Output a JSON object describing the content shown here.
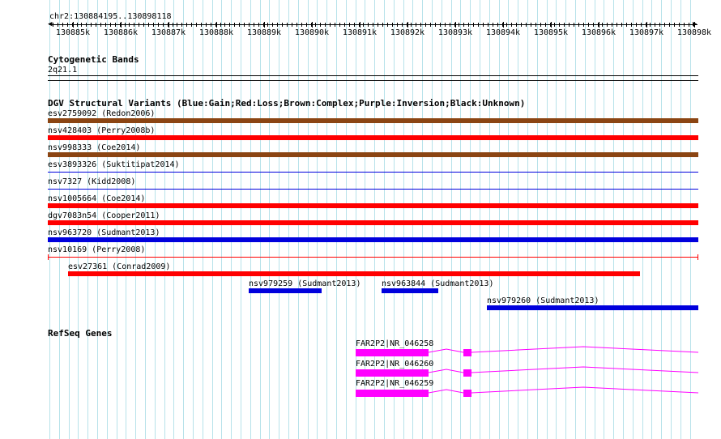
{
  "locus": "chr2:130884195..130898118",
  "ruler": {
    "ticks": [
      "130885k",
      "130886k",
      "130887k",
      "130888k",
      "130889k",
      "130890k",
      "130891k",
      "130892k",
      "130893k",
      "130894k",
      "130895k",
      "130896k",
      "130897k",
      "130898k"
    ]
  },
  "cyto": {
    "title": "Cytogenetic Bands",
    "band": "2q21.1"
  },
  "dgv": {
    "title": "DGV Structural Variants (Blue:Gain;Red:Loss;Brown:Complex;Purple:Inversion;Black:Unknown)",
    "colors": {
      "gain": "#0000dd",
      "loss": "#ff0000",
      "complex": "#8b4513",
      "unknown": "#000000"
    },
    "variants": [
      {
        "label": "esv2759092 (Redon2006)",
        "color": "#8b4513"
      },
      {
        "label": "nsv428403 (Perry2008b)",
        "color": "#ff0000"
      },
      {
        "label": "nsv998333 (Coe2014)",
        "color": "#8b4513"
      },
      {
        "label": "esv3893326 (Suktitipat2014)",
        "color": "#0000dd"
      },
      {
        "label": "nsv7327 (Kidd2008)",
        "color": "#0000dd"
      },
      {
        "label": "nsv1005664 (Coe2014)",
        "color": "#ff0000"
      },
      {
        "label": "dgv7083n54 (Cooper2011)",
        "color": "#ff0000"
      },
      {
        "label": "nsv963720 (Sudmant2013)",
        "color": "#0000dd"
      },
      {
        "label": "nsv10169 (Perry2008)",
        "color": "#ff0000"
      },
      {
        "label": "esv27361 (Conrad2009)",
        "color": "#ff0000"
      },
      {
        "label": "nsv979259 (Sudmant2013)",
        "color": "#0000dd"
      },
      {
        "label": "nsv963844 (Sudmant2013)",
        "color": "#0000dd"
      },
      {
        "label": "nsv979260 (Sudmant2013)",
        "color": "#0000dd"
      }
    ]
  },
  "refseq": {
    "title": "RefSeq Genes",
    "color": "#ff00ff",
    "genes": [
      {
        "label": "FAR2P2|NR_046258"
      },
      {
        "label": "FAR2P2|NR_046260"
      },
      {
        "label": "FAR2P2|NR_046259"
      }
    ]
  }
}
